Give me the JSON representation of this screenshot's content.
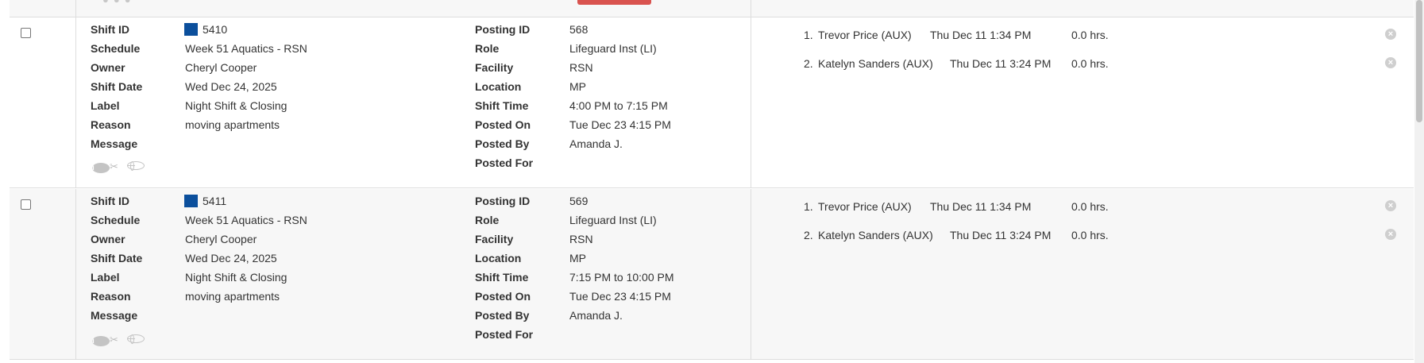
{
  "colors": {
    "swatch": "#0b4f9c",
    "accent_button": "#d9534f"
  },
  "labels": {
    "shift_id": "Shift ID",
    "schedule": "Schedule",
    "owner": "Owner",
    "shift_date": "Shift Date",
    "label": "Label",
    "reason": "Reason",
    "message": "Message",
    "posting_id": "Posting ID",
    "role": "Role",
    "facility": "Facility",
    "location": "Location",
    "shift_time": "Shift Time",
    "posted_on": "Posted On",
    "posted_by": "Posted By",
    "posted_for": "Posted For"
  },
  "icons": {
    "info": "info-icon",
    "cut": "scissors-icon",
    "globe": "globe-icon",
    "remove": "remove-icon"
  },
  "shifts": [
    {
      "shift_id": "5410",
      "schedule": "Week 51 Aquatics - RSN",
      "owner": "Cheryl Cooper",
      "shift_date": "Wed Dec 24, 2025",
      "label": "Night Shift & Closing",
      "reason": "moving apartments",
      "message": "",
      "posting_id": "568",
      "role": "Lifeguard Inst (LI)",
      "facility": "RSN",
      "location": "MP",
      "shift_time": "4:00 PM to 7:15 PM",
      "posted_on": "Tue Dec 23 4:15 PM",
      "posted_by": "Amanda J.",
      "posted_for": "",
      "requests": [
        {
          "num": "1.",
          "name": "Trevor Price (AUX)",
          "time": "Thu Dec 11 1:34 PM",
          "hours": "0.0 hrs."
        },
        {
          "num": "2.",
          "name": "Katelyn Sanders (AUX)",
          "time": "Thu Dec 11 3:24 PM",
          "hours": "0.0 hrs."
        }
      ]
    },
    {
      "shift_id": "5411",
      "schedule": "Week 51 Aquatics - RSN",
      "owner": "Cheryl Cooper",
      "shift_date": "Wed Dec 24, 2025",
      "label": "Night Shift & Closing",
      "reason": "moving apartments",
      "message": "",
      "posting_id": "569",
      "role": "Lifeguard Inst (LI)",
      "facility": "RSN",
      "location": "MP",
      "shift_time": "7:15 PM to 10:00 PM",
      "posted_on": "Tue Dec 23 4:15 PM",
      "posted_by": "Amanda J.",
      "posted_for": "",
      "requests": [
        {
          "num": "1.",
          "name": "Trevor Price (AUX)",
          "time": "Thu Dec 11 1:34 PM",
          "hours": "0.0 hrs."
        },
        {
          "num": "2.",
          "name": "Katelyn Sanders (AUX)",
          "time": "Thu Dec 11 3:24 PM",
          "hours": "0.0 hrs."
        }
      ]
    }
  ]
}
